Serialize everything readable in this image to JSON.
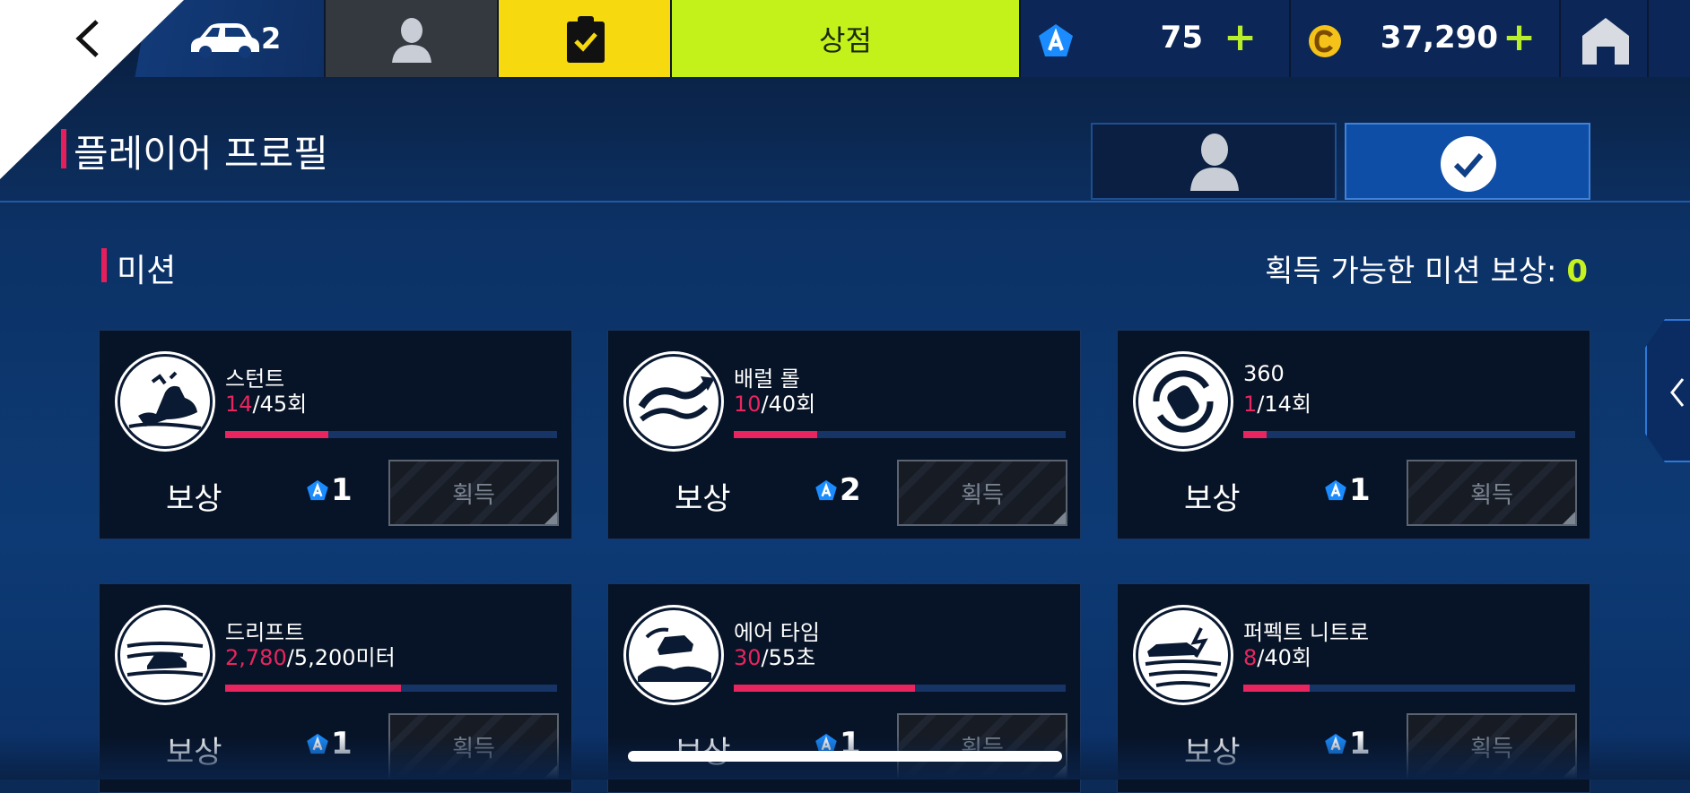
{
  "topbar": {
    "cars_count": "2",
    "shop_label": "상점",
    "tokens": "75",
    "credits": "37,290"
  },
  "header": {
    "title": "플레이어 프로필"
  },
  "missions": {
    "section_title": "미션",
    "available_label": "획득 가능한 미션 보상: ",
    "available_value": "0",
    "cards": [
      {
        "name": "스턴트",
        "current": "14",
        "total": "/45회",
        "progress": 0.31,
        "reward_label": "보상",
        "reward": "1",
        "claim": "획득",
        "icon": "stunt-icon"
      },
      {
        "name": "배럴 롤",
        "current": "10",
        "total": "/40회",
        "progress": 0.25,
        "reward_label": "보상",
        "reward": "2",
        "claim": "획득",
        "icon": "barrel-roll-icon"
      },
      {
        "name": "360",
        "current": "1",
        "total": "/14회",
        "progress": 0.07,
        "reward_label": "보상",
        "reward": "1",
        "claim": "획득",
        "icon": "spin-360-icon"
      },
      {
        "name": "드리프트",
        "current": "2,780",
        "total": "/5,200미터",
        "progress": 0.53,
        "reward_label": "보상",
        "reward": "1",
        "claim": "획득",
        "icon": "drift-icon"
      },
      {
        "name": "에어 타임",
        "current": "30",
        "total": "/55초",
        "progress": 0.545,
        "reward_label": "보상",
        "reward": "1",
        "claim": "획득",
        "icon": "air-time-icon"
      },
      {
        "name": "퍼펙트 니트로",
        "current": "8",
        "total": "/40회",
        "progress": 0.2,
        "reward_label": "보상",
        "reward": "1",
        "claim": "획득",
        "icon": "perfect-nitro-icon"
      }
    ]
  },
  "colors": {
    "accent_pink": "#e8255f",
    "shop_green": "#c3f21b",
    "mission_yellow": "#f7d90f",
    "token_blue": "#1a8cff",
    "credit_gold": "#f5c21a"
  }
}
